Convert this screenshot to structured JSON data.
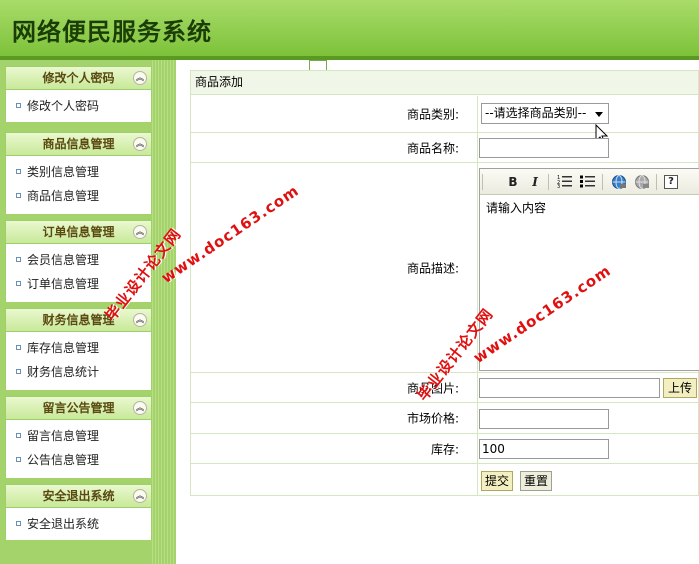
{
  "header": {
    "title": "网络便民服务系统"
  },
  "sidebar": {
    "groups": [
      {
        "title": "修改个人密码",
        "items": [
          "修改个人密码"
        ]
      },
      {
        "title": "商品信息管理",
        "items": [
          "类别信息管理",
          "商品信息管理"
        ]
      },
      {
        "title": "订单信息管理",
        "items": [
          "会员信息管理",
          "订单信息管理"
        ]
      },
      {
        "title": "财务信息管理",
        "items": [
          "库存信息管理",
          "财务信息统计"
        ]
      },
      {
        "title": "留言公告管理",
        "items": [
          "留言信息管理",
          "公告信息管理"
        ]
      },
      {
        "title": "安全退出系统",
        "items": [
          "安全退出系统"
        ]
      }
    ]
  },
  "form": {
    "heading": "商品添加",
    "category_label": "商品类别:",
    "category_value": "--请选择商品类别--",
    "name_label": "商品名称:",
    "name_value": "",
    "desc_label": "商品描述:",
    "desc_value": "请输入内容",
    "image_label": "商品图片:",
    "image_value": "",
    "upload_label": "上传",
    "price_label": "市场价格:",
    "price_value": "",
    "stock_label": "库存:",
    "stock_value": "100",
    "submit_label": "提交",
    "reset_label": "重置"
  },
  "editor_toolbar": [
    "bold-icon",
    "italic-icon",
    "ordered-list-icon",
    "unordered-list-icon",
    "link-icon",
    "unlink-icon",
    "help-icon"
  ],
  "watermarks": [
    "毕业设计论文网",
    "www.doc163.com"
  ]
}
